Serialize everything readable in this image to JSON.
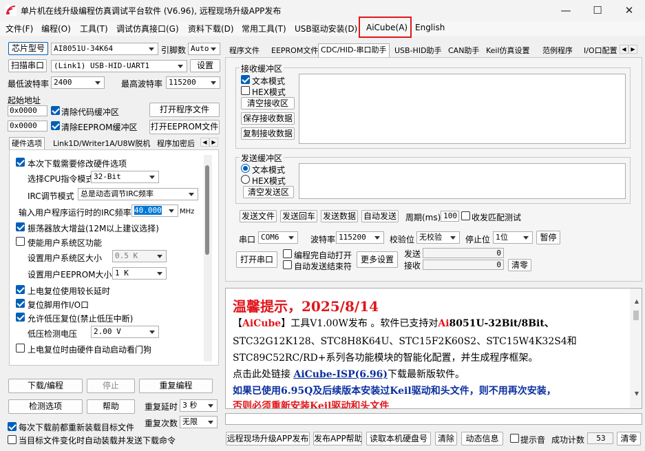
{
  "title": "单片机在线升级编程仿真调试平台软件 (V6.96), 远程现场升级APP发布",
  "menu": [
    "文件(F)",
    "编程(O)",
    "工具(T)",
    "调试仿真接口(G)",
    "资料下载(D)",
    "常用工具(T)",
    "USB驱动安装(D)",
    "AiCube(A)",
    "English"
  ],
  "left": {
    "chip_label": "芯片型号",
    "chip_value": "AI8051U-34K64",
    "pins_label": "引脚数",
    "pins_value": "Auto",
    "scan_label": "扫描串口",
    "port_value": "(Link1) USB-HID-UART1",
    "settings_label": "设置",
    "min_baud_label": "最低波特率",
    "min_baud_value": "2400",
    "max_baud_label": "最高波特率",
    "max_baud_value": "115200",
    "start_addr_label": "起始地址",
    "addr1": "0x0000",
    "clear_code_label": "清除代码缓冲区",
    "open_prog_label": "打开程序文件",
    "addr2": "0x0000",
    "clear_eeprom_label": "清除EEPROM缓冲区",
    "open_eeprom_label": "打开EEPROM文件",
    "tabs": [
      "硬件选项",
      "Link1D/Writer1A/U8W脱机",
      "程序加密后"
    ],
    "hw": {
      "modify_label": "本次下载需要修改硬件选项",
      "cpu_mode_label": "选择CPU指令模式",
      "cpu_mode_value": "32-Bit",
      "irc_mode_label": "IRC调节模式",
      "irc_mode_value": "总是动态调节IRC频率",
      "freq_label": "输入用户程序运行时的IRC频率",
      "freq_value": "40.000",
      "freq_unit": "MHz",
      "osc_label": "振荡器放大增益(12M以上建议选择)",
      "sys_area_label": "使能用户系统区功能",
      "sys_size_label": "设置用户系统区大小",
      "sys_size_value": "0.5 K",
      "eeprom_size_label": "设置用户EEPROM大小",
      "eeprom_size_value": "1   K",
      "long_delay_label": "上电复位使用较长延时",
      "reset_io_label": "复位脚用作I/O口",
      "lvr_label": "允许低压复位(禁止低压中断)",
      "lv_label": "低压检测电压",
      "lv_value": "2.00 V",
      "wdt_label": "上电复位时由硬件自动启动看门狗"
    },
    "download_label": "下载/编程",
    "stop_label": "停止",
    "reprogram_label": "重复编程",
    "detect_label": "检测选项",
    "help_label": "帮助",
    "repeat_delay_label": "重复延时",
    "repeat_delay_value": "3 秒",
    "repeat_count_label": "重复次数",
    "repeat_count_value": "无限",
    "reload_label": "每次下载前都重新装载目标文件",
    "auto_send_label": "当目标文件变化时自动装载并发送下载命令"
  },
  "right": {
    "tabs": [
      "程序文件",
      "EEPROM文件",
      "CDC/HID-串口助手",
      "USB-HID助手",
      "CAN助手",
      "Keil仿真设置",
      "范例程序",
      "I/O口配置"
    ],
    "recv": {
      "group": "接收缓冲区",
      "text_mode": "文本模式",
      "hex_mode": "HEX模式",
      "clear": "清空接收区",
      "save": "保存接收数据",
      "copy": "复制接收数据"
    },
    "send": {
      "group": "发送缓冲区",
      "text_mode": "文本模式",
      "hex_mode": "HEX模式",
      "clear": "清空发送区"
    },
    "send_file": "发送文件",
    "send_enter": "发送回车",
    "send_data": "发送数据",
    "auto_send": "自动发送",
    "period_label": "周期(ms)",
    "period_value": "100",
    "match_label": "收发匹配测试",
    "port_label": "串口",
    "port_value": "COM6",
    "baud_label": "波特率",
    "baud_value": "115200",
    "parity_label": "校验位",
    "parity_value": "无校验",
    "stop_label": "停止位",
    "stop_value": "1位",
    "pause_label": "暂停",
    "open_port_label": "打开串口",
    "auto_open_label": "编程完自动打开",
    "auto_end_label": "自动发送结束符",
    "more_label": "更多设置",
    "tx_label": "发送",
    "tx_value": "0",
    "rx_label": "接收",
    "rx_value": "0",
    "clear_label": "清零"
  },
  "notice": {
    "heading": "温馨提示，2025/8/14",
    "l1_a": "【",
    "l1_b": "AiCube",
    "l1_c": "】工具V1.00W发布 。软件已支持对",
    "l1_d": "Ai",
    "l1_e": "8051U-32Bit/8Bit、",
    "l2": "STC32G12K128、STC8H8K64U、STC15F2K60S2、STC15W4K32S4和",
    "l3": "STC89C52RC/RD+系列各功能模块的智能化配置，并生成程序框架。",
    "l4_a": "点击此处链接 ",
    "l4_b": "AiCube-ISP(6.96)",
    "l4_c": "下载最新版软件。",
    "l5": "如果已使用6.95Q及后续版本安装过Keil驱动和头文件，则不用再次安装，",
    "l6": "否则必须重新安装Keil驱动和头文件"
  },
  "bottom": {
    "remote_label": "远程现场升级APP发布",
    "app_help_label": "发布APP帮助",
    "disk_label": "读取本机硬盘号",
    "clear_label": "清除",
    "anim_label": "动态信息",
    "beep_label": "提示音",
    "success_label": "成功计数",
    "success_value": "53",
    "reset_label": "清零"
  }
}
